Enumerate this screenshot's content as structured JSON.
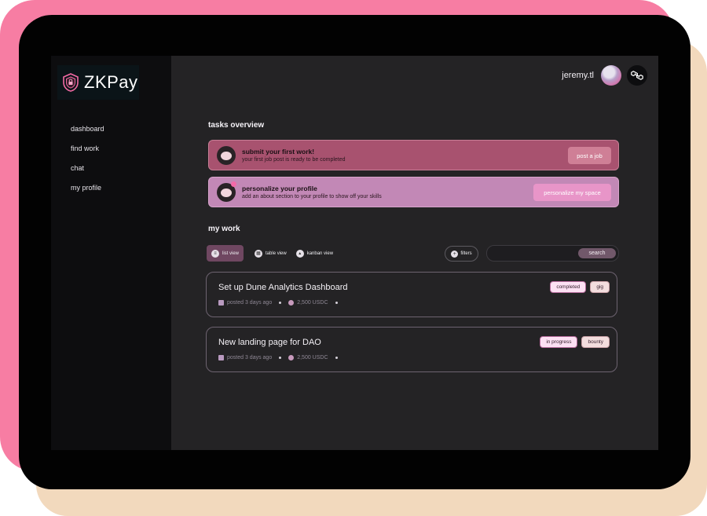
{
  "app": {
    "logo_text": "ZKPay"
  },
  "sidebar": {
    "items": [
      {
        "label": "dashboard"
      },
      {
        "label": "find work"
      },
      {
        "label": "chat"
      },
      {
        "label": "my profile"
      }
    ]
  },
  "header": {
    "username": "jeremy.tl",
    "chain_icon": "polygon-icon"
  },
  "tasks_overview": {
    "title": "tasks overview",
    "tasks": [
      {
        "title": "submit your first work!",
        "subtitle": "your first job post is ready to be completed",
        "button": "post a job"
      },
      {
        "title": "personalize your profile",
        "subtitle": "add an about section to your profile to show off your skills",
        "button": "personalize my space"
      }
    ]
  },
  "my_work": {
    "title": "my work",
    "views": [
      {
        "label": "list view",
        "active": true
      },
      {
        "label": "table view",
        "active": false
      },
      {
        "label": "kanban view",
        "active": false
      }
    ],
    "filters_label": "filters",
    "search": {
      "placeholder": "",
      "button": "search"
    },
    "jobs": [
      {
        "title": "Set up Dune Analytics Dashboard",
        "posted": "posted 3 days ago",
        "amount": "2,500 USDC",
        "status": "completed",
        "kind": "gig"
      },
      {
        "title": "New landing page for DAO",
        "posted": "posted 3 days ago",
        "amount": "2,500 USDC",
        "status": "in progress",
        "kind": "bounty"
      }
    ]
  },
  "colors": {
    "accent_pink": "#f77da3",
    "task_rose": "#a8526f",
    "task_mauve": "#c288b6",
    "screen_bg": "#242325",
    "sidebar_bg": "#0d0d0f"
  }
}
